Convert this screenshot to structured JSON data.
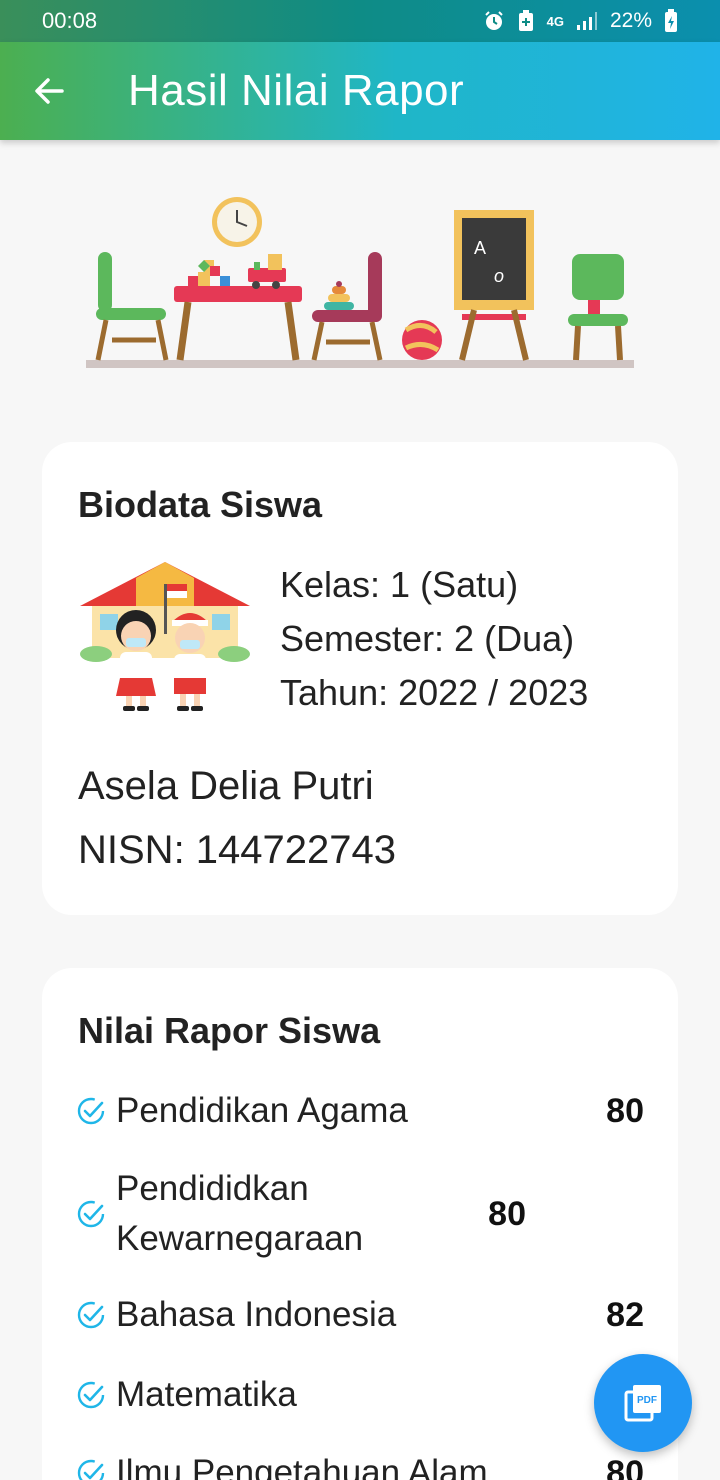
{
  "status": {
    "time": "00:08",
    "battery": "22%",
    "network": "4G",
    "icons": [
      "alarm-icon",
      "battery-saver-icon",
      "signal-icon",
      "battery-icon"
    ]
  },
  "appbar": {
    "title": "Hasil Nilai Rapor",
    "back_icon": "arrow-left-icon"
  },
  "biodata": {
    "title": "Biodata Siswa",
    "kelas": "Kelas: 1 (Satu)",
    "semester": "Semester: 2 (Dua)",
    "tahun": "Tahun: 2022 / 2023",
    "name": "Asela Delia Putri",
    "nisn": "NISN: 144722743"
  },
  "grades": {
    "title": "Nilai Rapor Siswa",
    "items": [
      {
        "subject": "Pendidikan Agama",
        "value": "80"
      },
      {
        "subject": "Pendididkan Kewarnegaraan",
        "value": "80"
      },
      {
        "subject": "Bahasa Indonesia",
        "value": "82"
      },
      {
        "subject": "Matematika",
        "value": ""
      },
      {
        "subject": "Ilmu Pengetahuan Alam",
        "value": "80"
      }
    ]
  },
  "fab": {
    "icon": "pdf-icon",
    "label": "PDF"
  },
  "colors": {
    "accent": "#2196f3",
    "appbar_start": "#4caf50",
    "appbar_end": "#20b3e8",
    "check": "#1fb6e8"
  }
}
